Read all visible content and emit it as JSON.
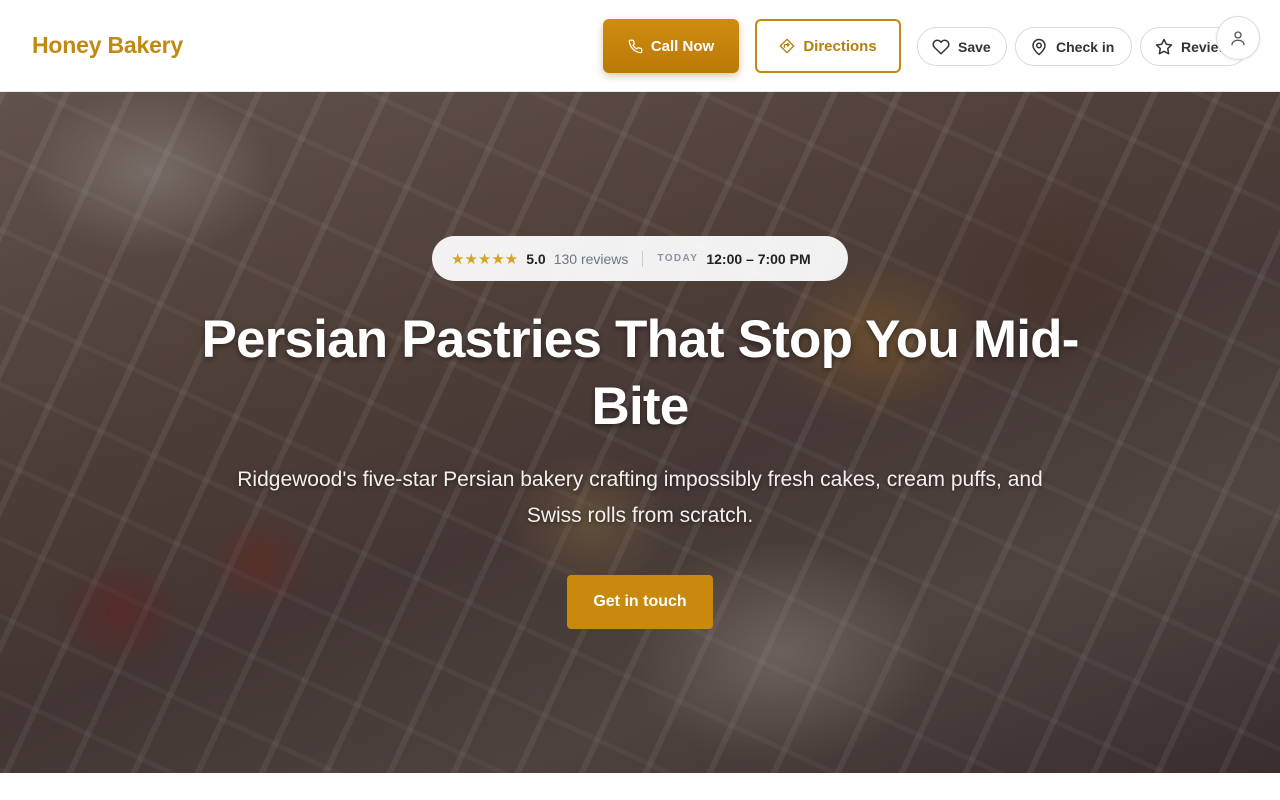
{
  "brand": {
    "name": "Honey Bakery",
    "color": "#c08a12"
  },
  "header": {
    "call_label": "Call Now",
    "call_icon": "phone-icon",
    "directions_label": "Directions",
    "directions_icon": "directions-icon",
    "save_label": "Save",
    "save_icon": "heart-icon",
    "checkin_label": "Check in",
    "checkin_icon": "map-pin-icon",
    "review_label": "Review",
    "review_icon": "star-icon",
    "account_icon": "user-icon"
  },
  "hero": {
    "stars": "★★★★★",
    "rating_value": "5.0",
    "review_count": "130 reviews",
    "today_label": "TODAY",
    "hours": "12:00 – 7:00 PM",
    "headline": "Persian Pastries That Stop You Mid-Bite",
    "subtitle": "Ridgewood's five-star Persian bakery crafting impossibly fresh cakes, cream puffs, and Swiss rolls from scratch.",
    "cta_label": "Get in touch"
  },
  "colors": {
    "accent": "#c8890d",
    "star": "#d7a321"
  }
}
